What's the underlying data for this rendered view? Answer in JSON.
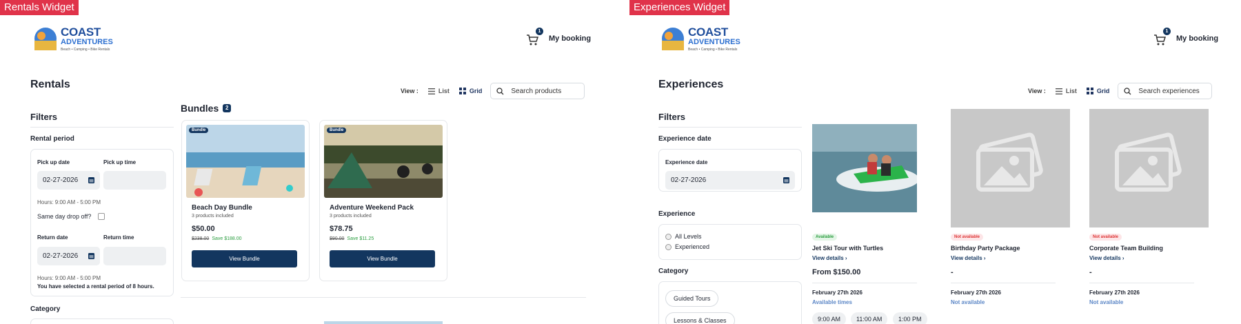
{
  "colors": {
    "tag_bg": "#e0334a",
    "primary": "#13365f",
    "available": "#2a9d3f",
    "unavailable": "#d33333"
  },
  "rentals": {
    "widget_tag": "Rentals Widget",
    "logo": {
      "title": "COAST",
      "subtitle": "ADVENTURES",
      "tagline": "Beach • Camping • Bike Rentals"
    },
    "booking": {
      "label": "My booking",
      "count": "1"
    },
    "page_title": "Rentals",
    "view": {
      "label": "View :",
      "list": "List",
      "grid": "Grid",
      "search_placeholder": "Search products"
    },
    "filters": {
      "title": "Filters",
      "rental_period": "Rental period",
      "pickup_date_label": "Pick up date",
      "pickup_date": "02-27-2026",
      "pickup_time_label": "Pick up time",
      "hours1": "Hours: 9:00 AM - 5:00 PM",
      "same_day": "Same day drop off?",
      "return_date_label": "Return date",
      "return_date": "02-27-2026",
      "return_time_label": "Return time",
      "hours2": "Hours: 9:00 AM - 5:00 PM",
      "period_note": "You have selected a rental period of 8 hours.",
      "category": "Category"
    },
    "bundles": {
      "title": "Bundles",
      "count": "2",
      "items": [
        {
          "tag": "Bundle",
          "name": "Beach Day Bundle",
          "sub": "3 products included",
          "price": "$50.00",
          "old": "$238.00",
          "save": "Save $188.00",
          "button": "View Bundle"
        },
        {
          "tag": "Bundle",
          "name": "Adventure Weekend Pack",
          "sub": "3 products included",
          "price": "$78.75",
          "old": "$90.00",
          "save": "Save $11.25",
          "button": "View Bundle"
        }
      ]
    }
  },
  "experiences": {
    "widget_tag": "Experiences Widget",
    "logo": {
      "title": "COAST",
      "subtitle": "ADVENTURES",
      "tagline": "Beach • Camping • Bike Rentals"
    },
    "booking": {
      "label": "My booking",
      "count": "1"
    },
    "page_title": "Experiences",
    "view": {
      "label": "View :",
      "list": "List",
      "grid": "Grid",
      "search_placeholder": "Search experiences"
    },
    "filters": {
      "title": "Filters",
      "exp_date_section": "Experience date",
      "exp_date_label": "Experience date",
      "exp_date": "02-27-2026",
      "experience": "Experience",
      "levels": [
        "All Levels",
        "Experienced"
      ],
      "category": "Category",
      "categories": [
        "Guided Tours",
        "Lessons & Classes"
      ]
    },
    "items": [
      {
        "status": "Available",
        "name": "Jet Ski Tour with Turtles",
        "details": "View details",
        "price": "From $150.00",
        "date": "February 27th 2026",
        "avail": "Available times",
        "times": [
          "9:00 AM",
          "11:00 AM",
          "1:00 PM"
        ]
      },
      {
        "status": "Not available",
        "name": "Birthday Party Package",
        "details": "View details",
        "price": "-",
        "date": "February 27th 2026",
        "avail": "Not available"
      },
      {
        "status": "Not available",
        "name": "Corporate Team Building",
        "details": "View details",
        "price": "-",
        "date": "February 27th 2026",
        "avail": "Not available"
      }
    ]
  }
}
